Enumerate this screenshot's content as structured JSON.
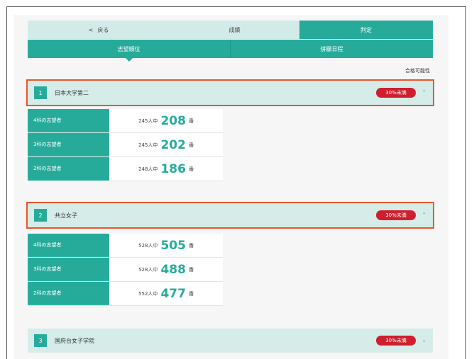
{
  "nav": {
    "back_chevron": "<",
    "back_label": "戻る",
    "grades_label": "成績",
    "judge_label": "判定"
  },
  "subtabs": [
    {
      "label": "志望順位"
    },
    {
      "label": "併願日程"
    }
  ],
  "column_label": "合格可能性",
  "schools": [
    {
      "rank": "1",
      "name": "日本大学第二",
      "possibility": "30%未満",
      "expanded": true,
      "rows": [
        {
          "label": "4科の志望者",
          "total": "245人中",
          "position": "208",
          "unit": "番"
        },
        {
          "label": "3科の志望者",
          "total": "245人中",
          "position": "202",
          "unit": "番"
        },
        {
          "label": "2科の志望者",
          "total": "248人中",
          "position": "186",
          "unit": "番"
        }
      ]
    },
    {
      "rank": "2",
      "name": "共立女子",
      "possibility": "30%未満",
      "expanded": true,
      "rows": [
        {
          "label": "4科の志望者",
          "total": "528人中",
          "position": "505",
          "unit": "番"
        },
        {
          "label": "3科の志望者",
          "total": "528人中",
          "position": "488",
          "unit": "番"
        },
        {
          "label": "2科の志望者",
          "total": "552人中",
          "position": "477",
          "unit": "番"
        }
      ]
    },
    {
      "rank": "3",
      "name": "国府台女子学院",
      "possibility": "30%未満",
      "expanded": false,
      "rows": []
    }
  ],
  "icons": {
    "expand_up": "chevron-up-icon",
    "expand_down": "chevron-down-icon"
  },
  "colors": {
    "teal": "#26ab9b",
    "light_teal": "#d6ece9",
    "badge_red": "#cf1f2e",
    "highlight": "#e8572a"
  }
}
